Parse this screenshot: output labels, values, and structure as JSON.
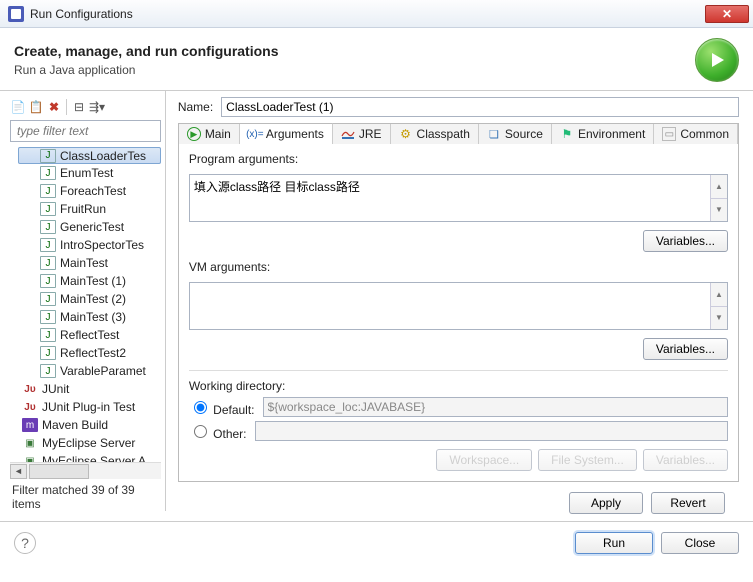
{
  "window": {
    "title": "Run Configurations"
  },
  "header": {
    "title": "Create, manage, and run configurations",
    "subtitle": "Run a Java application"
  },
  "toolbar": {
    "filter_placeholder": "type filter text"
  },
  "tree": {
    "items": [
      {
        "label": "ClassLoaderTes",
        "icon": "ji",
        "selected": true
      },
      {
        "label": "EnumTest",
        "icon": "ji"
      },
      {
        "label": "ForeachTest",
        "icon": "ji"
      },
      {
        "label": "FruitRun",
        "icon": "ji"
      },
      {
        "label": "GenericTest",
        "icon": "ji"
      },
      {
        "label": "IntroSpectorTes",
        "icon": "ji"
      },
      {
        "label": "MainTest",
        "icon": "ji"
      },
      {
        "label": "MainTest (1)",
        "icon": "ji"
      },
      {
        "label": "MainTest (2)",
        "icon": "ji"
      },
      {
        "label": "MainTest (3)",
        "icon": "ji"
      },
      {
        "label": "ReflectTest",
        "icon": "ji"
      },
      {
        "label": "ReflectTest2",
        "icon": "ji"
      },
      {
        "label": "VarableParamet",
        "icon": "ji"
      },
      {
        "label": "JUnit",
        "icon": "ju",
        "level0": true
      },
      {
        "label": "JUnit Plug-in Test",
        "icon": "ju",
        "level0": true
      },
      {
        "label": "Maven Build",
        "icon": "mvn",
        "level0": true
      },
      {
        "label": "MyEclipse Server",
        "icon": "srv",
        "level0": true
      },
      {
        "label": "MyEclipse Server A",
        "icon": "srv",
        "level0": true
      }
    ]
  },
  "filter_status": "Filter matched 39 of 39 items",
  "detail": {
    "name_label": "Name:",
    "name_value": "ClassLoaderTest (1)",
    "tabs": [
      "Main",
      "Arguments",
      "JRE",
      "Classpath",
      "Source",
      "Environment",
      "Common"
    ],
    "program_args_label": "Program arguments:",
    "program_args_value": "填入源class路径 目标class路径",
    "vm_args_label": "VM arguments:",
    "vm_args_value": "",
    "variables_btn": "Variables...",
    "working_dir_label": "Working directory:",
    "wd_default_label": "Default:",
    "wd_default_value": "${workspace_loc:JAVABASE}",
    "wd_other_label": "Other:",
    "wd_workspace_btn": "Workspace...",
    "wd_filesystem_btn": "File System...",
    "wd_variables_btn": "Variables..."
  },
  "actions": {
    "apply": "Apply",
    "revert": "Revert",
    "run": "Run",
    "close": "Close"
  }
}
